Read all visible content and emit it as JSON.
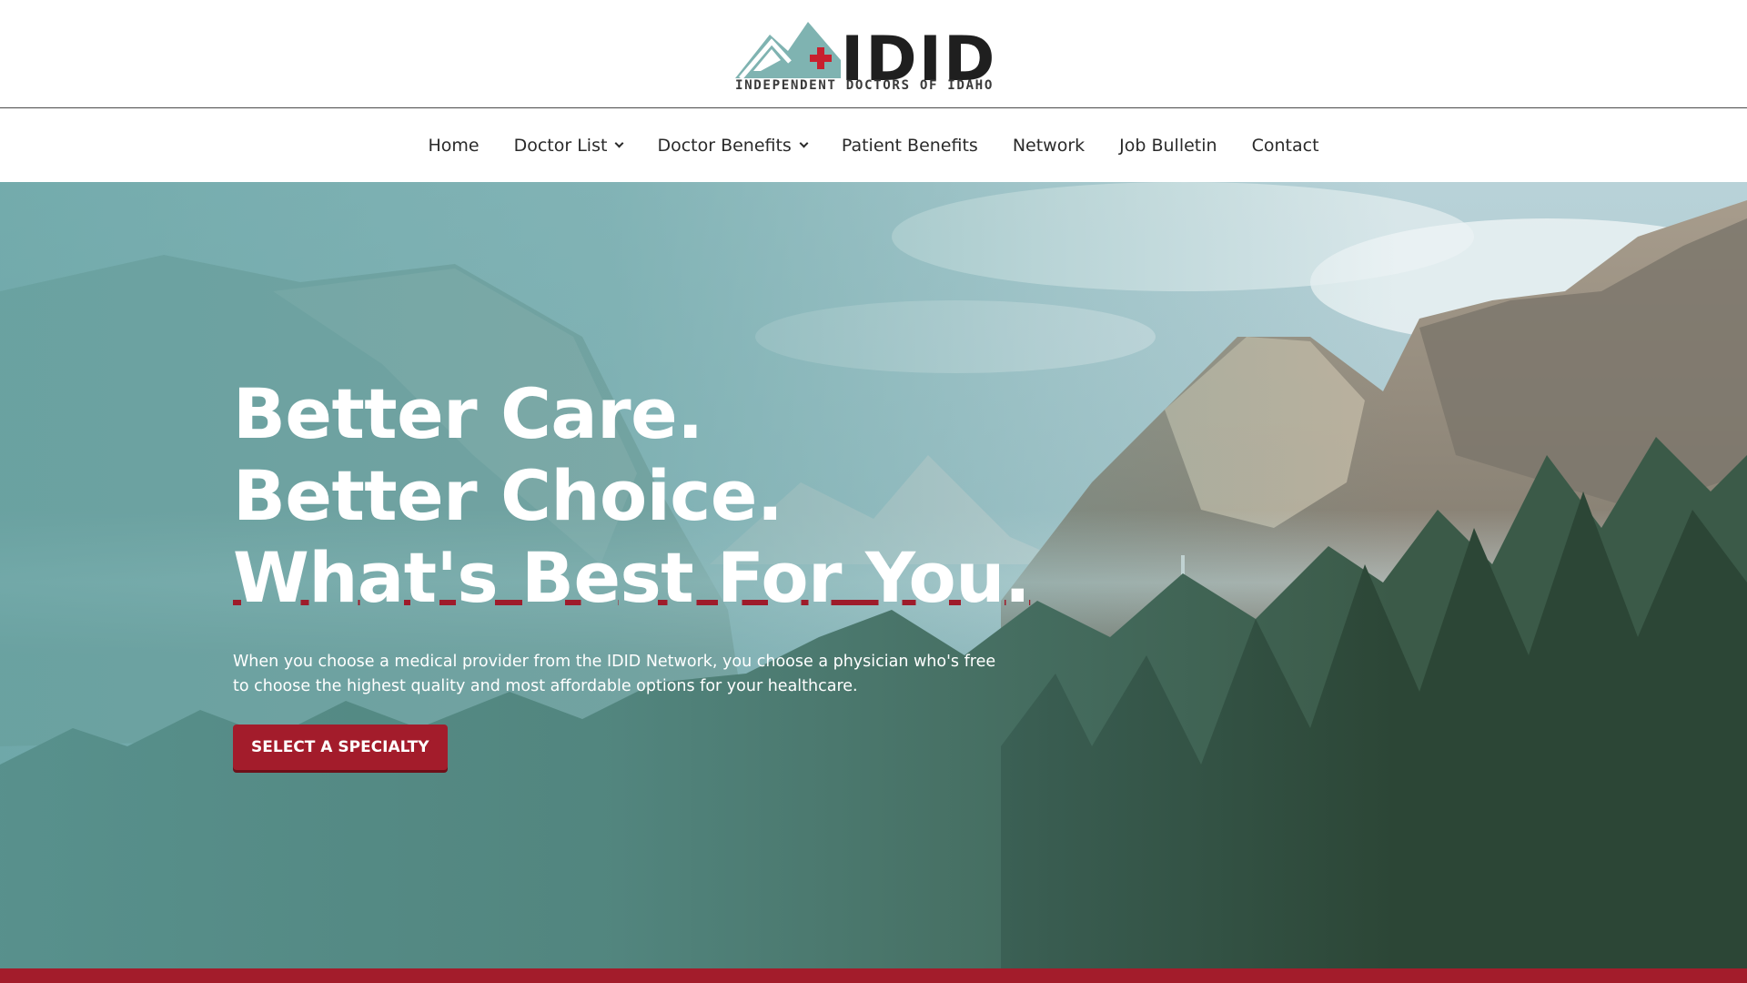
{
  "logo": {
    "wordmark": "IDID",
    "tagline": "INDEPENDENT DOCTORS OF IDAHO",
    "mountain_icon": "mountain-cross-icon"
  },
  "nav": {
    "items": [
      {
        "label": "Home",
        "has_dropdown": false
      },
      {
        "label": "Doctor List",
        "has_dropdown": true
      },
      {
        "label": "Doctor Benefits",
        "has_dropdown": true
      },
      {
        "label": "Patient Benefits",
        "has_dropdown": false
      },
      {
        "label": "Network",
        "has_dropdown": false
      },
      {
        "label": "Job Bulletin",
        "has_dropdown": false
      },
      {
        "label": "Contact",
        "has_dropdown": false
      }
    ]
  },
  "hero": {
    "headline_1": "Better Care.",
    "headline_2": "Better Choice.",
    "headline_3": "What's Best For You.",
    "subtext": "When you choose a medical provider from the IDID Network, you choose a physician who's free to choose the highest quality and most affordable options for your healthcare.",
    "cta_label": "SELECT A SPECIALTY",
    "background_image": "yosemite-valley-landscape"
  },
  "colors": {
    "brand_red": "#a31c2b",
    "brand_teal": "#7fb3b1",
    "text_dark": "#2a2a2a",
    "white": "#ffffff"
  }
}
